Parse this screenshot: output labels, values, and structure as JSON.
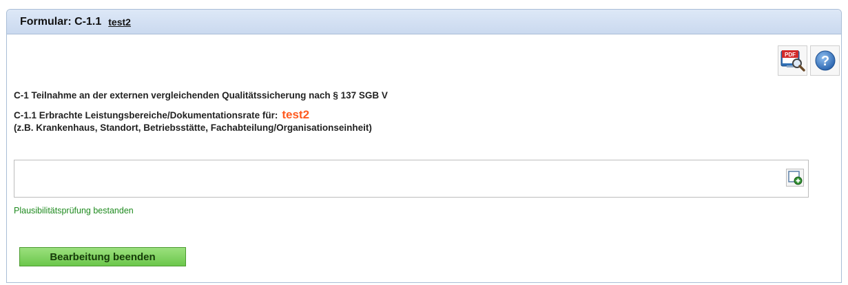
{
  "header": {
    "title_prefix": "Formular: C-1.1",
    "title_link": "test2"
  },
  "toolbar": {
    "pdf_label": "PDF",
    "pdf_icon": "pdf-preview-icon",
    "help_icon": "help-icon"
  },
  "content": {
    "section_title": "C-1 Teilnahme an der externen vergleichenden Qualitätssicherung nach § 137 SGB V",
    "subsection_label": "C-1.1 Erbrachte Leistungsbereiche/Dokumentationsrate für:",
    "subsection_value": "test2",
    "subsection_hint": "(z.B. Krankenhaus, Standort, Betriebsstätte, Fachabteilung/Organisationseinheit)",
    "input_value": "",
    "add_icon": "add-entry-icon"
  },
  "status": {
    "text": "Plausibilitätsprüfung bestanden",
    "color": "#1e8a1e"
  },
  "actions": {
    "finish_label": "Bearbeitung beenden"
  },
  "colors": {
    "accent": "#ff5a1f",
    "header_bg": "#d4e1f4",
    "button_green": "#7fd35c"
  }
}
